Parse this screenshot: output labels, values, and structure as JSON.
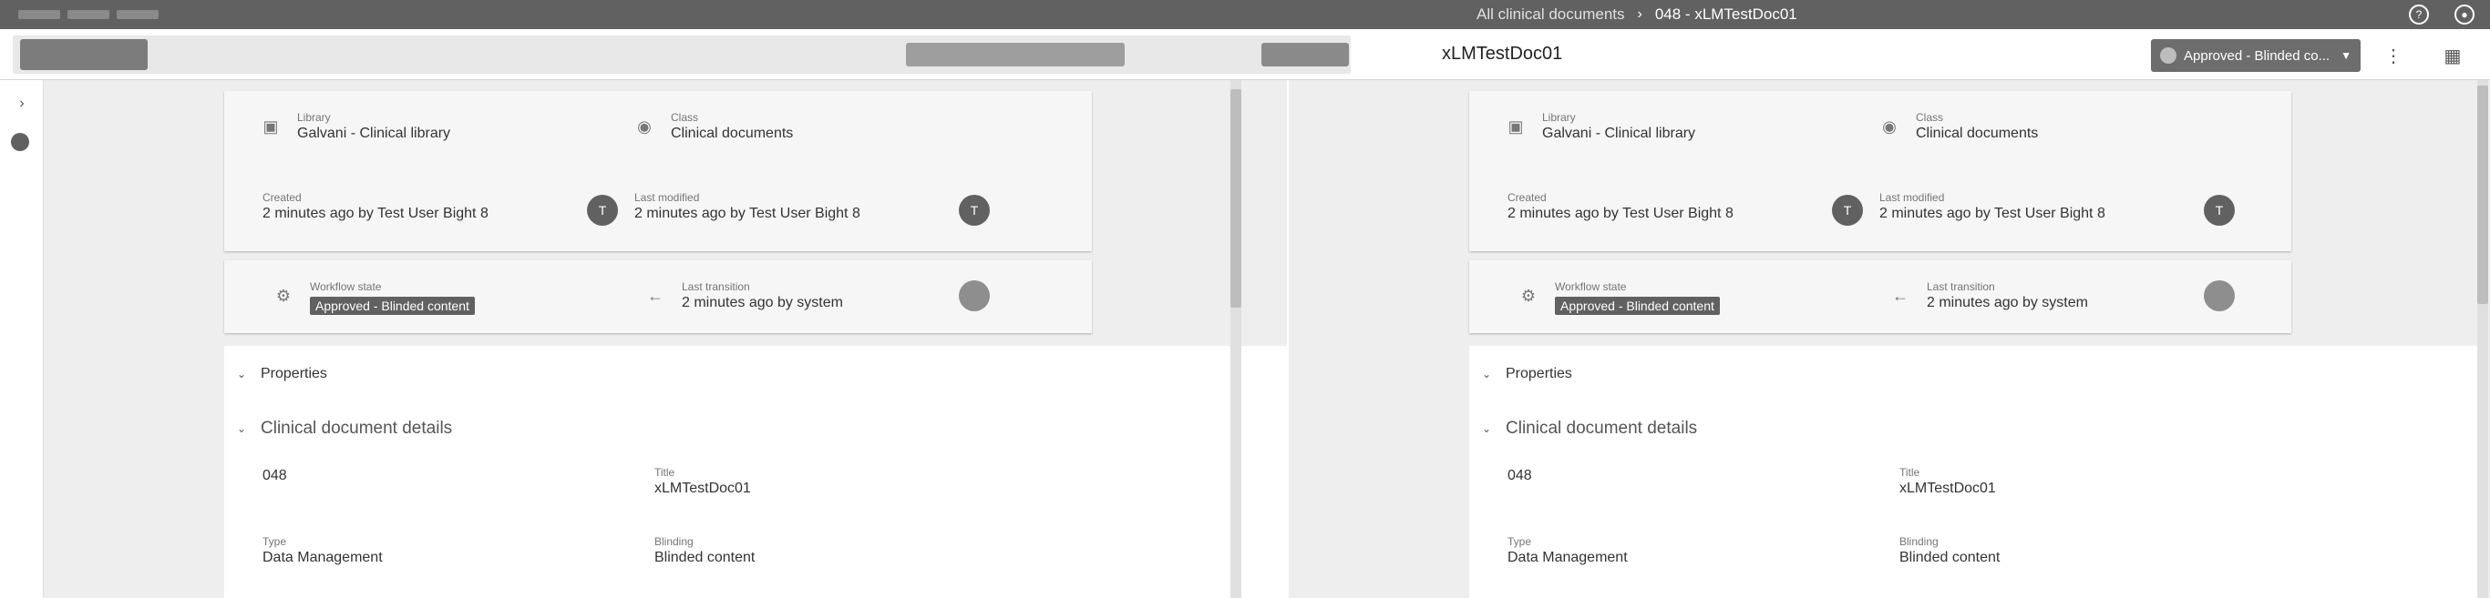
{
  "breadcrumb": {
    "items": [
      "All clinical documents",
      "048 - xLMTestDoc01"
    ]
  },
  "toolbar": {
    "document_title": "xLMTestDoc01",
    "status_label": "Approved - Blinded co..."
  },
  "left_panel": {
    "library_label": "Library",
    "library_value": "Galvani - Clinical library",
    "class_label": "Class",
    "class_value": "Clinical documents",
    "created_label": "Created",
    "created_value": "2 minutes ago by Test User Bight 8",
    "last_modified_label": "Last modified",
    "last_modified_value": "2 minutes ago by Test User Bight 8",
    "workflow_label": "Workflow state",
    "workflow_value": "Approved - Blinded content",
    "last_transition_label": "Last transition",
    "last_transition_value": "2 minutes ago by system",
    "properties_label": "Properties",
    "clinical_details_label": "Clinical document details",
    "number_value": "048",
    "title_label": "Title",
    "title_value": "xLMTestDoc01",
    "type_label": "Type",
    "type_value": "Data Management",
    "blinding_label": "Blinding",
    "blinding_value": "Blinded content"
  },
  "right_panel": {
    "library_label": "Library",
    "library_value": "Galvani - Clinical library",
    "class_label": "Class",
    "class_value": "Clinical documents",
    "created_label": "Created",
    "created_value": "2 minutes ago by Test User Bight 8",
    "last_modified_label": "Last modified",
    "last_modified_value": "2 minutes ago by Test User Bight 8",
    "workflow_label": "Workflow state",
    "workflow_value": "Approved - Blinded content",
    "last_transition_label": "Last transition",
    "last_transition_value": "2 minutes ago by system",
    "properties_label": "Properties",
    "clinical_details_label": "Clinical document details",
    "number_value": "048",
    "title_label": "Title",
    "title_value": "xLMTestDoc01",
    "type_label": "Type",
    "type_value": "Data Management",
    "blinding_label": "Blinding",
    "blinding_value": "Blinded content"
  },
  "icons": {
    "library": "library-icon",
    "class": "class-icon",
    "workflow": "workflow-icon",
    "transition": "arrow-left-icon",
    "expand": "chevron-right-icon",
    "collapse": "chevron-down-icon"
  },
  "colors": {
    "topbar": "#616161",
    "background": "#eeeeee",
    "status_chip": "#616161"
  }
}
